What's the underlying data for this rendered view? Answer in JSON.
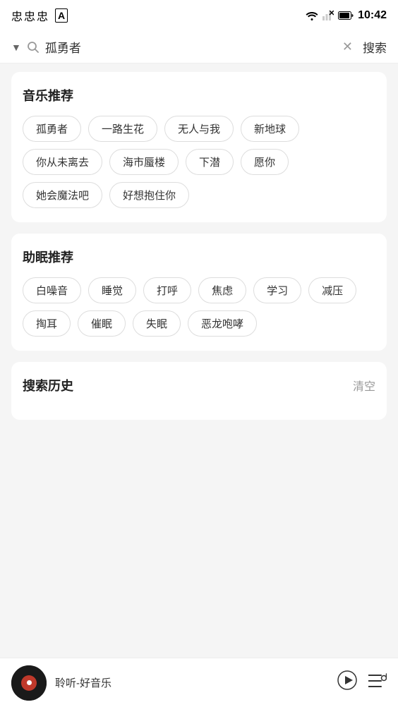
{
  "statusBar": {
    "time": "10:42"
  },
  "searchBar": {
    "query": "孤勇者",
    "searchLabel": "搜索"
  },
  "musicSection": {
    "title": "音乐推荐",
    "tags": [
      "孤勇者",
      "一路生花",
      "无人与我",
      "新地球",
      "你从未离去",
      "海市蜃楼",
      "下潜",
      "愿你",
      "她会魔法吧",
      "好想抱住你"
    ]
  },
  "sleepSection": {
    "title": "助眠推荐",
    "tags": [
      "白噪音",
      "睡觉",
      "打呼",
      "焦虑",
      "学习",
      "减压",
      "掏耳",
      "催眠",
      "失眠",
      "恶龙咆哮"
    ]
  },
  "historySection": {
    "title": "搜索历史",
    "clearLabel": "清空"
  },
  "player": {
    "title": "聆听-好音乐"
  }
}
